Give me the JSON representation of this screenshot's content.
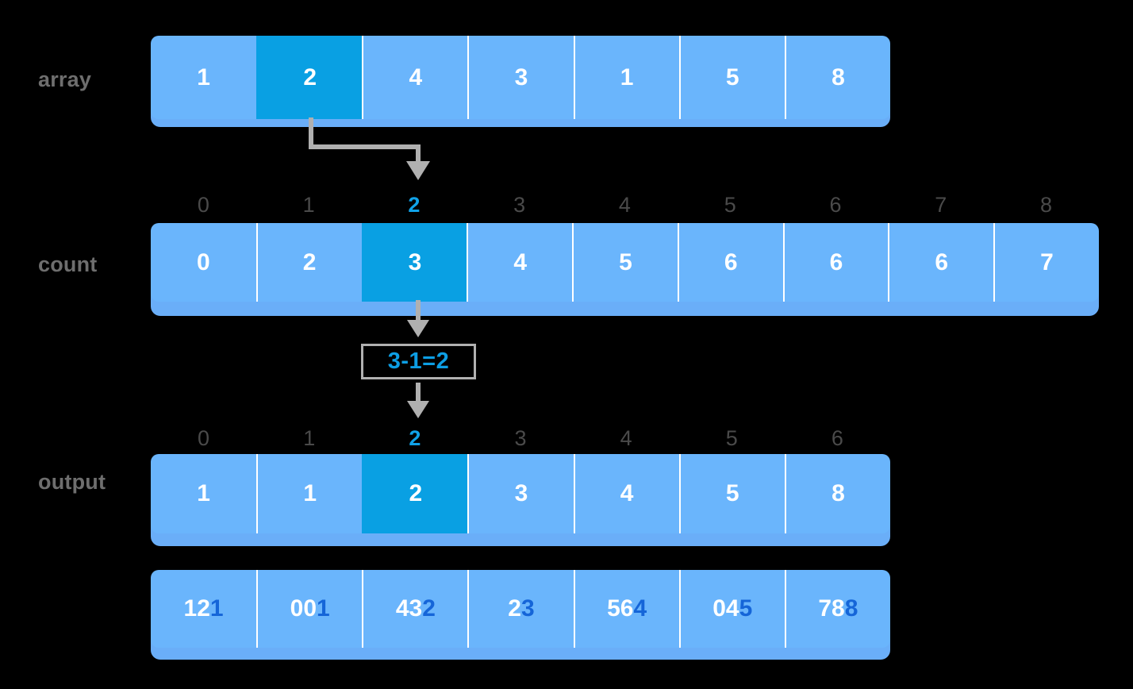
{
  "diagram": {
    "title": "counting-sort-step",
    "background": "#000000",
    "colors": {
      "cell": "#6ab5fc",
      "cell_highlight": "#09a0e3",
      "cell_base": "#6aaef8",
      "label": "#6e6e6e",
      "index": "#4a4a4a",
      "index_active": "#10a2e8",
      "connector": "#b0b0b0",
      "digit_white": "#ffffff",
      "digit_blue": "#1565d8",
      "formula_text": "#0d9ee4"
    }
  },
  "rows": {
    "array": {
      "label": "array",
      "values": [
        "1",
        "2",
        "4",
        "3",
        "1",
        "5",
        "8"
      ],
      "highlight_index": 1
    },
    "count": {
      "label": "count",
      "indices": [
        "0",
        "1",
        "2",
        "3",
        "4",
        "5",
        "6",
        "7",
        "8"
      ],
      "values": [
        "0",
        "2",
        "3",
        "4",
        "5",
        "6",
        "6",
        "6",
        "7"
      ],
      "highlight_index": 2
    },
    "output": {
      "label": "output",
      "indices": [
        "0",
        "1",
        "2",
        "3",
        "4",
        "5",
        "6"
      ],
      "values": [
        "1",
        "1",
        "2",
        "3",
        "4",
        "5",
        "8"
      ],
      "highlight_index": 2
    },
    "trace": {
      "cells": [
        {
          "prefix": "12",
          "suffix": "1"
        },
        {
          "prefix": "00",
          "suffix": "1"
        },
        {
          "prefix": "43",
          "suffix": "2"
        },
        {
          "prefix": "2",
          "suffix": "3"
        },
        {
          "prefix": "56",
          "suffix": "4"
        },
        {
          "prefix": "04",
          "suffix": "5"
        },
        {
          "prefix": "78",
          "suffix": "8"
        }
      ]
    }
  },
  "formula": {
    "text": "3-1=2"
  }
}
